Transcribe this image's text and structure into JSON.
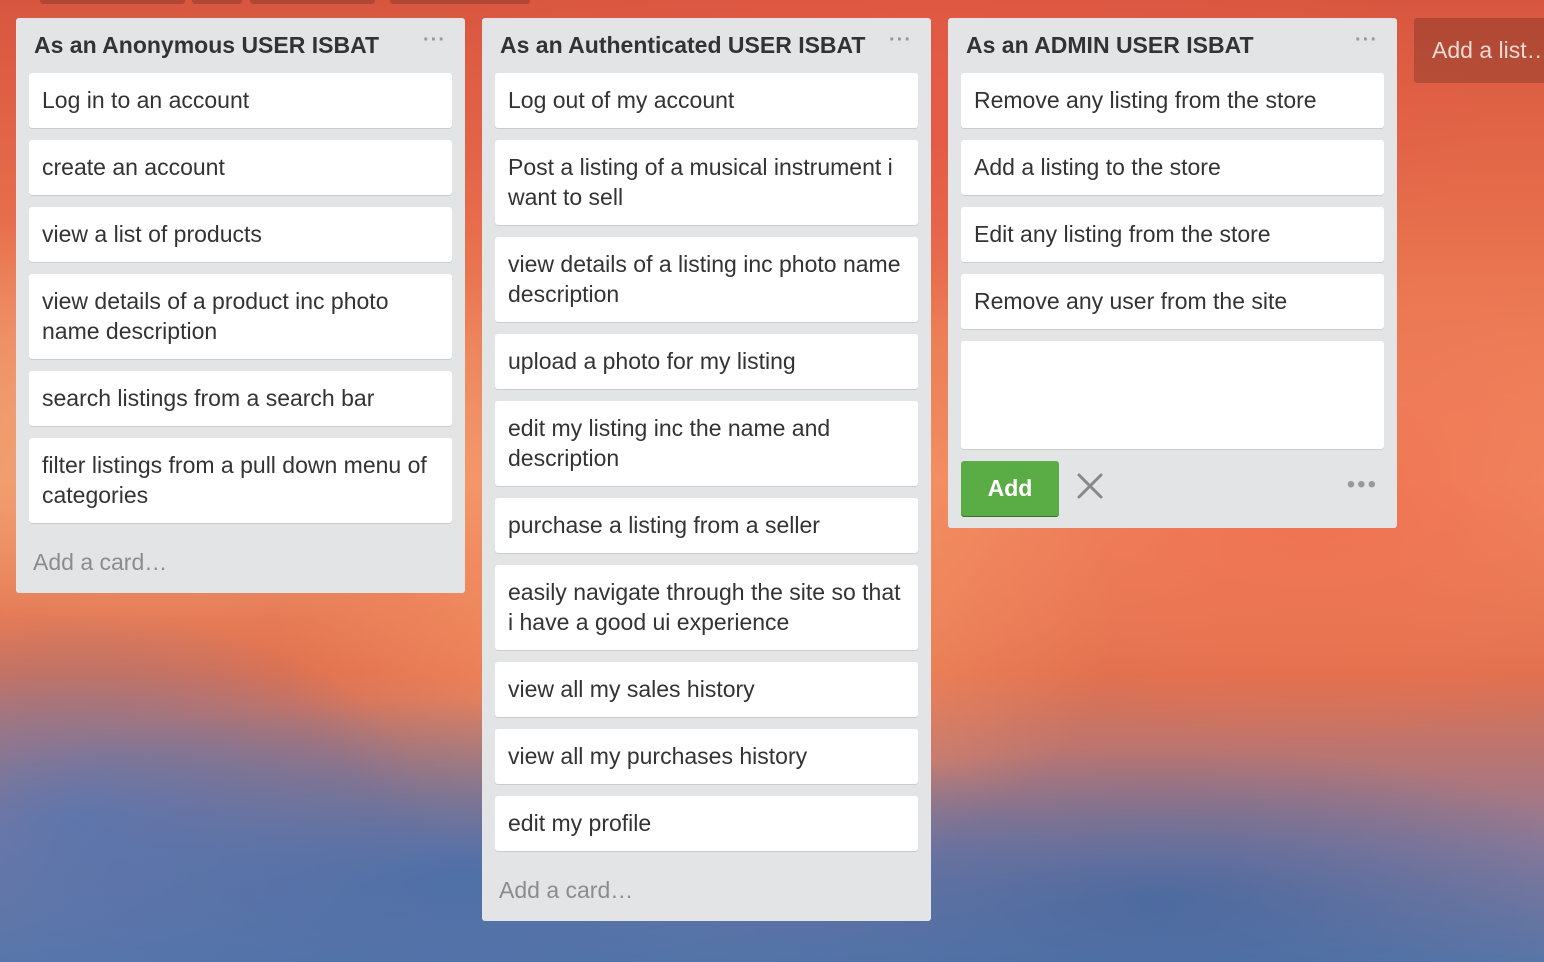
{
  "lists": [
    {
      "title": "As an Anonymous USER ISBAT",
      "menu": "···",
      "cards": [
        "Log in to an account",
        "create an account",
        "view a list of products",
        "view details of a product inc photo name description",
        "search listings from a search bar",
        "filter listings from a pull down menu of categories"
      ],
      "add_card": "Add a card…"
    },
    {
      "title": "As an Authenticated USER ISBAT",
      "menu": "···",
      "cards": [
        "Log out of my account",
        "Post a listing of a musical instrument i want to sell",
        "view details of a listing inc photo name description",
        "upload a photo for my listing",
        "edit my listing inc the name and description",
        "purchase a listing from a seller",
        "easily navigate through the site so that i have a good ui experience",
        "view all my sales history",
        "view all my purchases history",
        "edit my profile"
      ],
      "add_card": "Add a card…"
    },
    {
      "title": "As an ADMIN USER ISBAT",
      "menu": "···",
      "cards": [
        "Remove any listing from the store",
        "Add a listing to the store",
        "Edit any listing from the store",
        "Remove any user from the site"
      ],
      "composer": {
        "value": "",
        "add_label": "Add",
        "more": "•••"
      }
    }
  ],
  "add_list": "Add a list…",
  "colors": {
    "list_bg": "#e2e4e6",
    "card_bg": "#ffffff",
    "add_button": "#5aac44",
    "text": "#333333",
    "muted": "#8c8c8c"
  },
  "icons": {
    "list_menu": "ellipsis-icon",
    "composer_close": "close-icon",
    "composer_more": "ellipsis-icon"
  }
}
